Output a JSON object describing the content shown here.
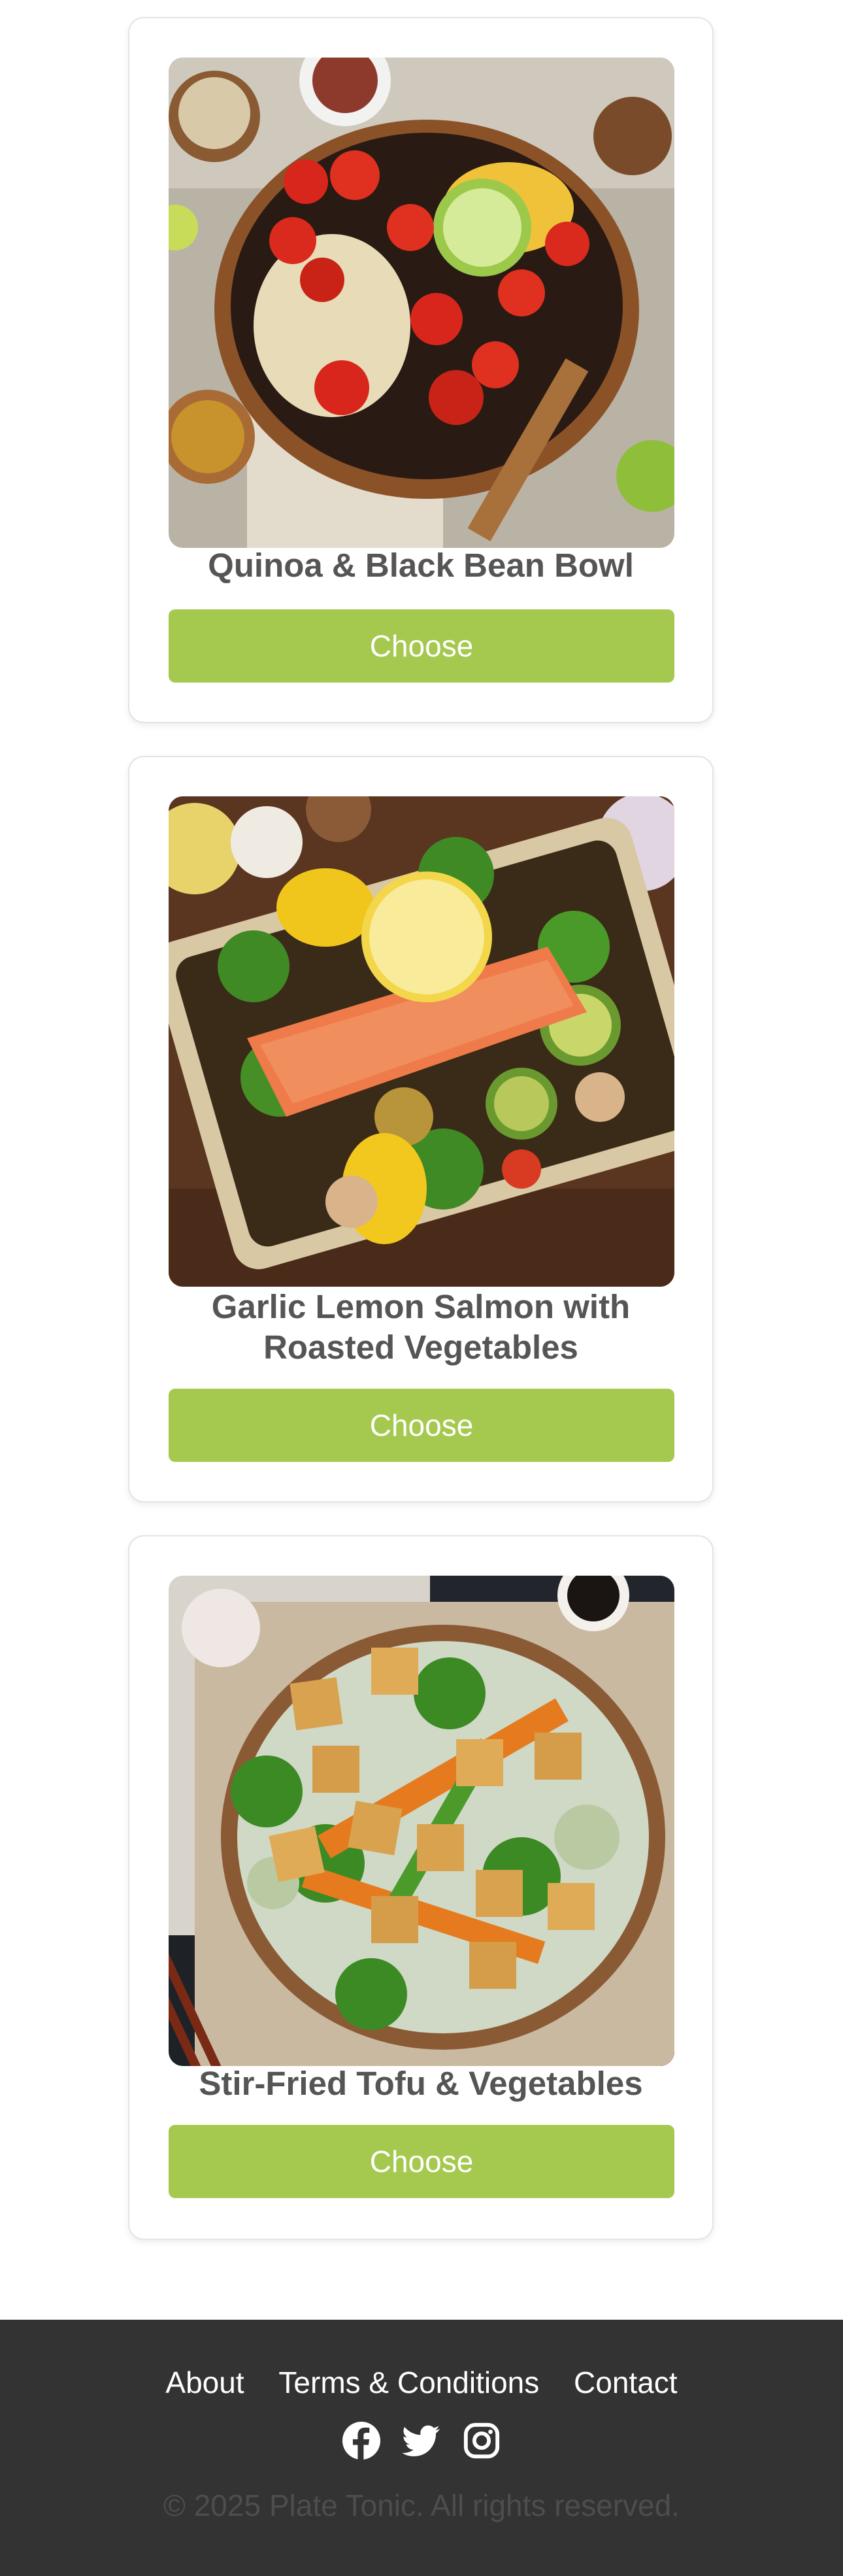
{
  "meals": [
    {
      "title": "Quinoa & Black Bean Bowl",
      "button_label": "Choose",
      "image_icon": "quinoa-bowl-photo"
    },
    {
      "title": "Garlic Lemon Salmon with Roasted Vegetables",
      "button_label": "Choose",
      "image_icon": "salmon-tray-photo"
    },
    {
      "title": "Stir-Fried Tofu & Vegetables",
      "button_label": "Choose",
      "image_icon": "tofu-stirfry-photo"
    }
  ],
  "footer": {
    "links": [
      "About",
      "Terms & Conditions",
      "Contact"
    ],
    "social_icons": [
      "facebook-icon",
      "twitter-icon",
      "instagram-icon"
    ],
    "copyright": "© 2025 Plate Tonic. All rights reserved."
  },
  "colors": {
    "button": "#a5c94f",
    "footer_bg": "#333333",
    "title_text": "#555555"
  }
}
